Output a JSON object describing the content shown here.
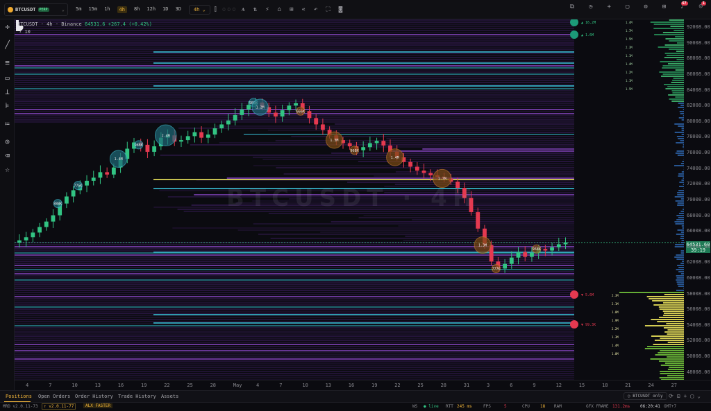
{
  "topbar": {
    "symbol": "BTCUSDT",
    "market_type": "PERP",
    "timeframes": [
      "5m",
      "15m",
      "1h",
      "4h",
      "8h",
      "12h",
      "1D",
      "3D"
    ],
    "active_timeframe": "4h",
    "interval_select": "4h",
    "notification_count": "67",
    "alert_count": "1"
  },
  "chart": {
    "title_symbol": "BTCUSDT",
    "title_interval": "4h",
    "exchange": "Binance",
    "last_price": "64531.6",
    "change": "+267.4",
    "change_pct": "(+0.42%)",
    "sub_label": "10",
    "watermark": "BTCUSDT · 4H",
    "current_price_label": "64531.60",
    "countdown": "39:19",
    "ask_markers": [
      "16.2M",
      "1.6M"
    ],
    "bid_markers": [
      "5.6M",
      "99.3K"
    ],
    "bubble_labels": [
      "888K",
      "775K",
      "1.4M",
      "988K",
      "2.4M",
      "988K",
      "1.2M",
      "666K",
      "1.3M",
      "968K",
      "1.4M",
      "1.7M",
      "1.3M",
      "777K",
      "968K"
    ],
    "depth_labels_ask": [
      "1.4M",
      "1.7M",
      "1.5M",
      "2.3M",
      "1.1M",
      "1.4M",
      "1.2M",
      "1.1M",
      "1.5M"
    ],
    "depth_labels_bid": [
      "2.3M",
      "2.1M",
      "1.0M",
      "1.9M",
      "2.2M",
      "1.3M",
      "1.4M",
      "1.0M"
    ],
    "y_ticks": [
      "92008.00",
      "90008.00",
      "88008.00",
      "86008.00",
      "84008.00",
      "82008.00",
      "80008.00",
      "78008.00",
      "76008.00",
      "74008.00",
      "72008.00",
      "70008.00",
      "68008.00",
      "66008.00",
      "64008.00",
      "62008.00",
      "60008.00",
      "58008.00",
      "56008.00",
      "54008.00",
      "52008.00",
      "50008.00",
      "48008.00"
    ],
    "x_ticks": [
      "4",
      "7",
      "10",
      "13",
      "16",
      "19",
      "22",
      "25",
      "28",
      "May",
      "4",
      "7",
      "10",
      "13",
      "16",
      "19",
      "22",
      "25",
      "28",
      "31",
      "3",
      "6",
      "9",
      "12",
      "15",
      "18",
      "21",
      "24",
      "27"
    ]
  },
  "bottom_tabs": {
    "items": [
      "Positions",
      "Open Orders",
      "Order History",
      "Trade History",
      "Assets"
    ],
    "active": "Positions",
    "filter": "BTCUSDT only"
  },
  "statusbar": {
    "app_version": "MRD v2.0.11-73",
    "build": "v2.0.11-77",
    "mode": "ALX FASTER",
    "ws_label": "WS",
    "ws_status": "live",
    "rtt_label": "RTT",
    "rtt_value": "245 ms",
    "fps_label": "FPS",
    "fps_value": "5",
    "cpu_label": "CPU",
    "cpu_value": "18",
    "ram_label": "RAM",
    "gfx_label": "GFX FRAME",
    "gfx_value": "131.2ms",
    "clock": "06:20:41",
    "tz": "GMT+7"
  },
  "colors": {
    "up": "#32c483",
    "down": "#e53950",
    "accent": "#f0b43a",
    "heat_low": "#3a1d5c",
    "heat_mid": "#7a3fb0",
    "heat_high": "#35b5c8",
    "heat_peak": "#e8e05a"
  },
  "chart_data": {
    "type": "candlestick-heatmap",
    "series": [
      {
        "name": "BTCUSDT",
        "values": [
          64800,
          65200,
          65800,
          66500,
          67200,
          68000,
          69500,
          70400,
          71200,
          71800,
          72400,
          72800,
          73500,
          73200,
          74100,
          75200,
          76500,
          77300,
          77000,
          76100,
          76800,
          77900,
          78200,
          77400,
          77600,
          78100,
          78600,
          77900,
          78300,
          79100,
          79600,
          80100,
          80800,
          81500,
          82100,
          82400,
          81800,
          81100,
          80600,
          81400,
          82000,
          82300,
          81300,
          80400,
          79600,
          78900,
          78200,
          77600,
          77200,
          76800,
          76300,
          76700,
          77200,
          77500,
          76900,
          76100,
          75400,
          74800,
          74200,
          73700,
          73400,
          73100,
          72900,
          72700,
          72300,
          71500,
          70200,
          68400,
          66300,
          64200,
          62100,
          61200,
          61800,
          62600,
          63300,
          62700,
          63200,
          63700,
          63500,
          63900,
          64300,
          64531
        ]
      }
    ]
  }
}
